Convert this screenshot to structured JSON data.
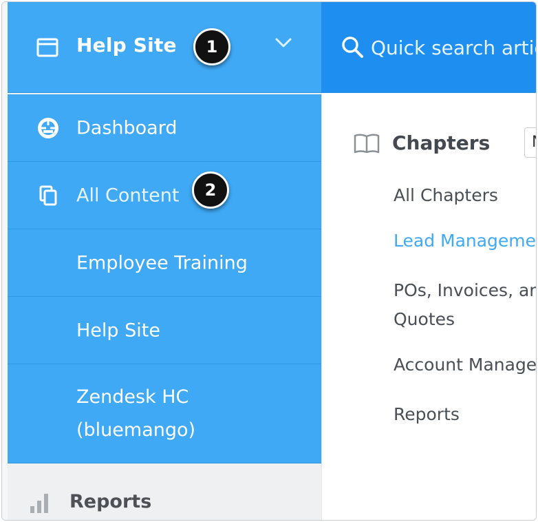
{
  "sidebar": {
    "site_title": "Help Site",
    "badge_one": "1",
    "badge_two": "2",
    "items": [
      {
        "label": "Dashboard"
      },
      {
        "label": "All Content"
      },
      {
        "label": "Employee Training"
      },
      {
        "label": "Help Site"
      },
      {
        "label": "Zendesk HC (bluemango)"
      }
    ],
    "reports_label": "Reports"
  },
  "search": {
    "placeholder": "Quick search artic"
  },
  "main": {
    "section_title": "Chapters",
    "sort_label": "N",
    "chapters": [
      {
        "label": "All Chapters",
        "active": false
      },
      {
        "label": "Lead Management",
        "active": true
      },
      {
        "label": "POs, Invoices, and",
        "active": false
      },
      {
        "label": "Quotes",
        "active": false
      },
      {
        "label": "Account Managem",
        "active": false
      },
      {
        "label": "Reports",
        "active": false
      }
    ]
  },
  "colors": {
    "sidebar_blue": "#3fa9f5",
    "topbar_blue": "#1e8ff0",
    "active_link": "#3fa9f5"
  }
}
